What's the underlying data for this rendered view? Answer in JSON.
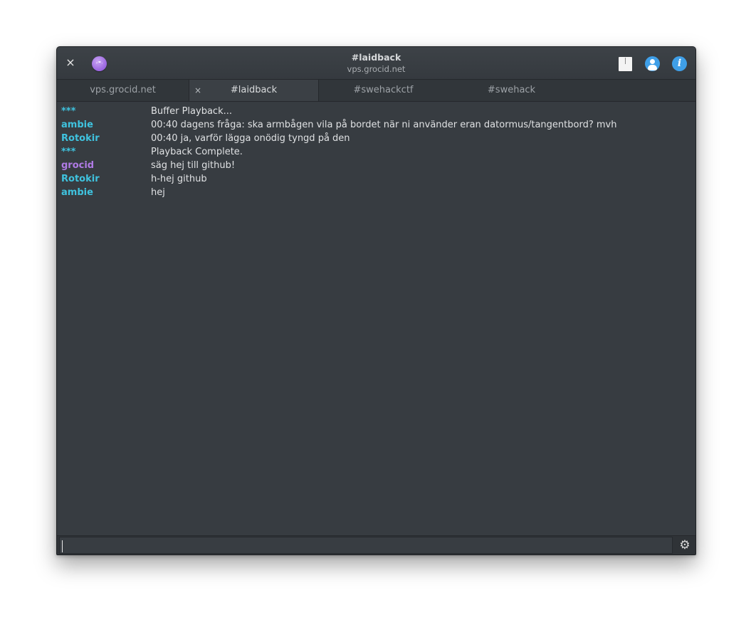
{
  "window": {
    "title": "#laidback",
    "subtitle": "vps.grocid.net",
    "close_glyph": "×",
    "icons": [
      "close-icon",
      "app-icon",
      "book-icon",
      "user-icon",
      "info-icon"
    ],
    "info_glyph": "i"
  },
  "tabs": [
    {
      "label": "vps.grocid.net",
      "active": false
    },
    {
      "label": "#laidback",
      "active": true,
      "close_glyph": "×"
    },
    {
      "label": "#swehackctf",
      "active": false
    },
    {
      "label": "#swehack",
      "active": false
    }
  ],
  "colors": {
    "nick_cyan": "#3fc3df",
    "nick_purple": "#b07be6",
    "background": "#373c41",
    "text": "#dfe1e3"
  },
  "messages": [
    {
      "nick": "***",
      "text": "Buffer Playback...",
      "color": "#3fc3df"
    },
    {
      "nick": "ambie",
      "text": "00:40 dagens fråga: ska armbågen vila på bordet när ni använder eran datormus/tangentbord? mvh",
      "color": "#3fc3df"
    },
    {
      "nick": "Rotokir",
      "text": "00:40 ja, varför lägga onödig tyngd på den",
      "color": "#3fc3df"
    },
    {
      "nick": "***",
      "text": "Playback Complete.",
      "color": "#3fc3df"
    },
    {
      "nick": "grocid",
      "text": "säg hej till github!",
      "color": "#b07be6"
    },
    {
      "nick": "Rotokir",
      "text": "h-hej github",
      "color": "#3fc3df"
    },
    {
      "nick": "ambie",
      "text": "hej",
      "color": "#3fc3df"
    }
  ],
  "input": {
    "value": "",
    "placeholder": ""
  },
  "settings_glyph": "⚙"
}
